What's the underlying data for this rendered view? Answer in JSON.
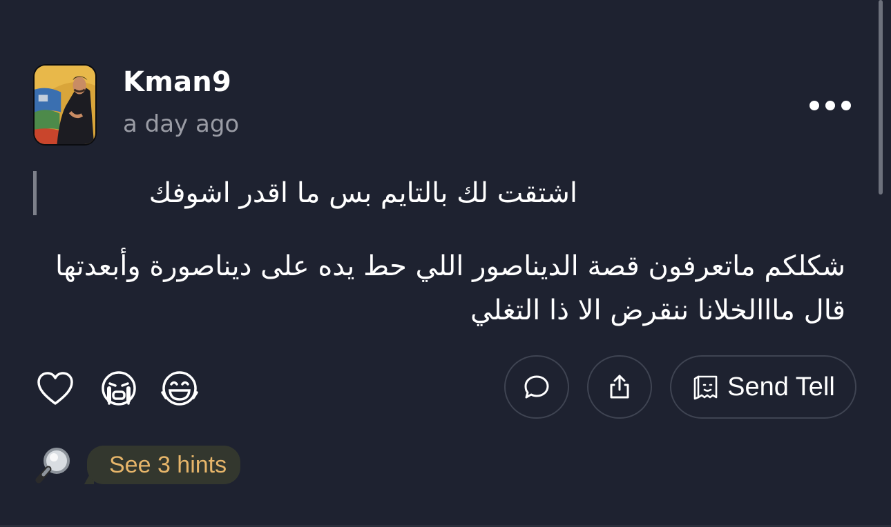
{
  "post": {
    "username": "Kman9",
    "timestamp": "a day ago",
    "quote": "اشتقت لك بالتايم بس ما اقدر اشوفك",
    "message": "شكلكم ماتعرفون قصة الديناصور اللي حط يده على ديناصورة وأبعدتها قال مااالخلانا ننقرض الا ذا التغلي"
  },
  "actions": {
    "send_tell_label": "Send Tell"
  },
  "hints": {
    "label": "See 3 hints"
  },
  "icons": {
    "like": "heart-icon",
    "cry": "crying-face-icon",
    "laugh": "laughing-face-icon",
    "comment": "comment-bubble-icon",
    "share": "share-icon",
    "tell": "tell-note-icon",
    "more": "more-dots-icon",
    "hint": "magnifier-icon"
  },
  "colors": {
    "background": "#1e2230",
    "hint_text": "#e6b56a",
    "hint_bg": "#33372e",
    "muted": "#9a9ca5"
  }
}
